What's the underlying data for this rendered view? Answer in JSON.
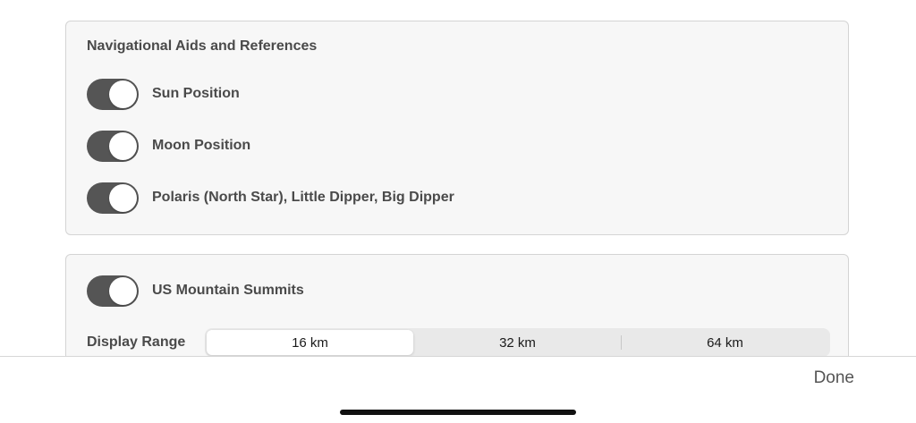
{
  "nav_aids": {
    "title": "Navigational Aids and References",
    "toggles": [
      {
        "label": "Sun Position",
        "on": true
      },
      {
        "label": "Moon Position",
        "on": true
      },
      {
        "label": "Polaris (North Star), Little Dipper, Big Dipper",
        "on": true
      }
    ]
  },
  "summits": {
    "toggle": {
      "label": "US Mountain Summits",
      "on": true
    },
    "range_label": "Display Range",
    "range_options": [
      "16 km",
      "32 km",
      "64 km"
    ],
    "range_selected": "16 km"
  },
  "footer": {
    "done_label": "Done"
  },
  "colors": {
    "toggle_on": "#555555",
    "card_bg": "#f7f7f7",
    "segment_bg": "#e9e9e9"
  }
}
